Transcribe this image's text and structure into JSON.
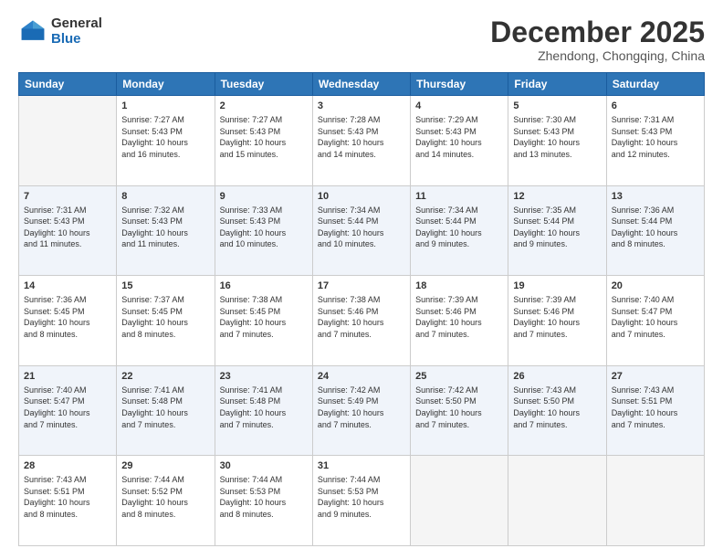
{
  "logo": {
    "general": "General",
    "blue": "Blue"
  },
  "header": {
    "month": "December 2025",
    "location": "Zhendong, Chongqing, China"
  },
  "weekdays": [
    "Sunday",
    "Monday",
    "Tuesday",
    "Wednesday",
    "Thursday",
    "Friday",
    "Saturday"
  ],
  "weeks": [
    [
      {
        "day": null,
        "data": null
      },
      {
        "day": "1",
        "sunrise": "7:27 AM",
        "sunset": "5:43 PM",
        "daylight": "10 hours and 16 minutes."
      },
      {
        "day": "2",
        "sunrise": "7:27 AM",
        "sunset": "5:43 PM",
        "daylight": "10 hours and 15 minutes."
      },
      {
        "day": "3",
        "sunrise": "7:28 AM",
        "sunset": "5:43 PM",
        "daylight": "10 hours and 14 minutes."
      },
      {
        "day": "4",
        "sunrise": "7:29 AM",
        "sunset": "5:43 PM",
        "daylight": "10 hours and 14 minutes."
      },
      {
        "day": "5",
        "sunrise": "7:30 AM",
        "sunset": "5:43 PM",
        "daylight": "10 hours and 13 minutes."
      },
      {
        "day": "6",
        "sunrise": "7:31 AM",
        "sunset": "5:43 PM",
        "daylight": "10 hours and 12 minutes."
      }
    ],
    [
      {
        "day": "7",
        "sunrise": "7:31 AM",
        "sunset": "5:43 PM",
        "daylight": "10 hours and 11 minutes."
      },
      {
        "day": "8",
        "sunrise": "7:32 AM",
        "sunset": "5:43 PM",
        "daylight": "10 hours and 11 minutes."
      },
      {
        "day": "9",
        "sunrise": "7:33 AM",
        "sunset": "5:43 PM",
        "daylight": "10 hours and 10 minutes."
      },
      {
        "day": "10",
        "sunrise": "7:34 AM",
        "sunset": "5:44 PM",
        "daylight": "10 hours and 10 minutes."
      },
      {
        "day": "11",
        "sunrise": "7:34 AM",
        "sunset": "5:44 PM",
        "daylight": "10 hours and 9 minutes."
      },
      {
        "day": "12",
        "sunrise": "7:35 AM",
        "sunset": "5:44 PM",
        "daylight": "10 hours and 9 minutes."
      },
      {
        "day": "13",
        "sunrise": "7:36 AM",
        "sunset": "5:44 PM",
        "daylight": "10 hours and 8 minutes."
      }
    ],
    [
      {
        "day": "14",
        "sunrise": "7:36 AM",
        "sunset": "5:45 PM",
        "daylight": "10 hours and 8 minutes."
      },
      {
        "day": "15",
        "sunrise": "7:37 AM",
        "sunset": "5:45 PM",
        "daylight": "10 hours and 8 minutes."
      },
      {
        "day": "16",
        "sunrise": "7:38 AM",
        "sunset": "5:45 PM",
        "daylight": "10 hours and 7 minutes."
      },
      {
        "day": "17",
        "sunrise": "7:38 AM",
        "sunset": "5:46 PM",
        "daylight": "10 hours and 7 minutes."
      },
      {
        "day": "18",
        "sunrise": "7:39 AM",
        "sunset": "5:46 PM",
        "daylight": "10 hours and 7 minutes."
      },
      {
        "day": "19",
        "sunrise": "7:39 AM",
        "sunset": "5:46 PM",
        "daylight": "10 hours and 7 minutes."
      },
      {
        "day": "20",
        "sunrise": "7:40 AM",
        "sunset": "5:47 PM",
        "daylight": "10 hours and 7 minutes."
      }
    ],
    [
      {
        "day": "21",
        "sunrise": "7:40 AM",
        "sunset": "5:47 PM",
        "daylight": "10 hours and 7 minutes."
      },
      {
        "day": "22",
        "sunrise": "7:41 AM",
        "sunset": "5:48 PM",
        "daylight": "10 hours and 7 minutes."
      },
      {
        "day": "23",
        "sunrise": "7:41 AM",
        "sunset": "5:48 PM",
        "daylight": "10 hours and 7 minutes."
      },
      {
        "day": "24",
        "sunrise": "7:42 AM",
        "sunset": "5:49 PM",
        "daylight": "10 hours and 7 minutes."
      },
      {
        "day": "25",
        "sunrise": "7:42 AM",
        "sunset": "5:50 PM",
        "daylight": "10 hours and 7 minutes."
      },
      {
        "day": "26",
        "sunrise": "7:43 AM",
        "sunset": "5:50 PM",
        "daylight": "10 hours and 7 minutes."
      },
      {
        "day": "27",
        "sunrise": "7:43 AM",
        "sunset": "5:51 PM",
        "daylight": "10 hours and 7 minutes."
      }
    ],
    [
      {
        "day": "28",
        "sunrise": "7:43 AM",
        "sunset": "5:51 PM",
        "daylight": "10 hours and 8 minutes."
      },
      {
        "day": "29",
        "sunrise": "7:44 AM",
        "sunset": "5:52 PM",
        "daylight": "10 hours and 8 minutes."
      },
      {
        "day": "30",
        "sunrise": "7:44 AM",
        "sunset": "5:53 PM",
        "daylight": "10 hours and 8 minutes."
      },
      {
        "day": "31",
        "sunrise": "7:44 AM",
        "sunset": "5:53 PM",
        "daylight": "10 hours and 9 minutes."
      },
      {
        "day": null,
        "data": null
      },
      {
        "day": null,
        "data": null
      },
      {
        "day": null,
        "data": null
      }
    ]
  ],
  "labels": {
    "sunrise": "Sunrise:",
    "sunset": "Sunset:",
    "daylight": "Daylight:"
  }
}
